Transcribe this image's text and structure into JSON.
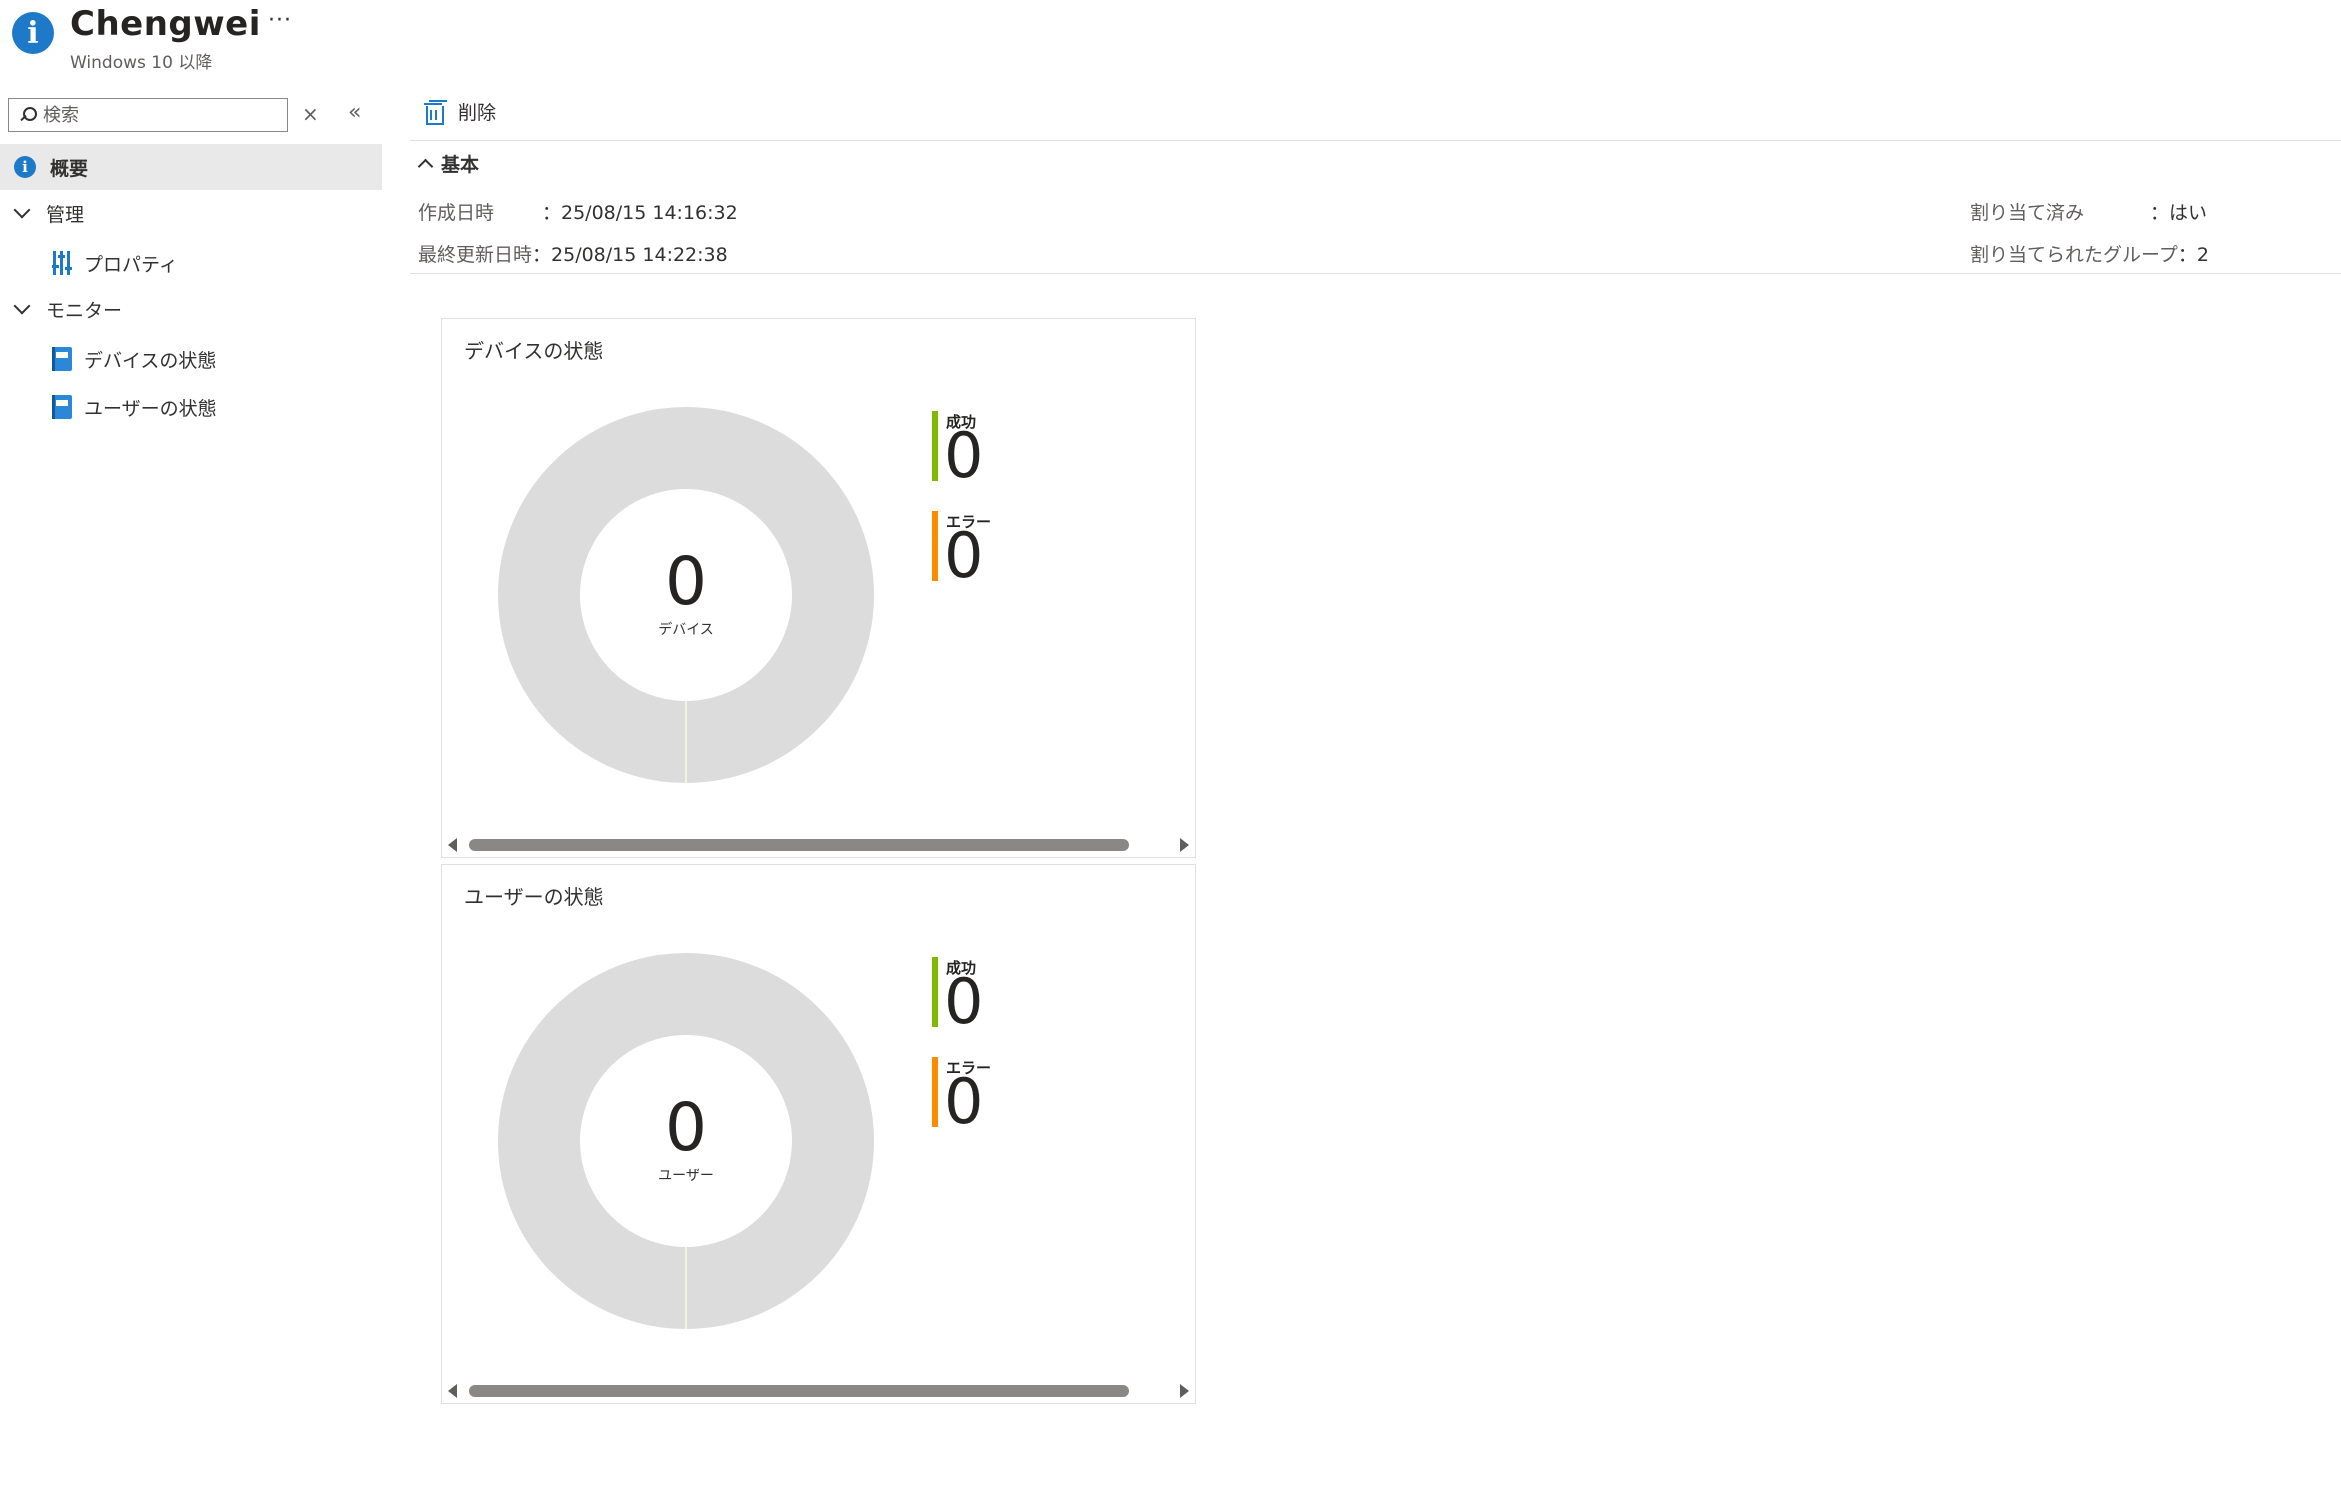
{
  "header": {
    "title": "Chengwei",
    "more": "···",
    "subtitle": "Windows 10 以降"
  },
  "sidebar": {
    "search_placeholder": "検索",
    "clear": "×",
    "collapse": "«",
    "items": [
      {
        "label": "概要",
        "icon": "info-icon",
        "active": true
      },
      {
        "label": "管理",
        "type": "group"
      },
      {
        "label": "プロパティ",
        "icon": "properties-icon"
      },
      {
        "label": "モニター",
        "type": "group"
      },
      {
        "label": "デバイスの状態",
        "icon": "book-icon"
      },
      {
        "label": "ユーザーの状態",
        "icon": "book-icon"
      }
    ]
  },
  "toolbar": {
    "delete_label": "削除"
  },
  "essentials": {
    "section_label": "基本",
    "created_label": "作成日時",
    "created_value": "：25/08/15 14:16:32",
    "modified_label": "最終更新日時",
    "modified_value": "：25/08/15 14:22:38",
    "assigned_label": "割り当て済み",
    "assigned_value": "：はい",
    "groups_label": "割り当てられたグループ",
    "groups_value": "：2"
  },
  "cards": [
    {
      "title": "デバイスの状態",
      "center_value": "0",
      "center_unit": "デバイス",
      "legend": [
        {
          "label": "成功",
          "value": "0",
          "color": "#7fba00"
        },
        {
          "label": "エラー",
          "value": "0",
          "color": "#ff8c00"
        }
      ]
    },
    {
      "title": "ユーザーの状態",
      "center_value": "0",
      "center_unit": "ユーザー",
      "legend": [
        {
          "label": "成功",
          "value": "0",
          "color": "#7fba00"
        },
        {
          "label": "エラー",
          "value": "0",
          "color": "#ff8c00"
        }
      ]
    }
  ],
  "colors": {
    "accent": "#1e7ac8",
    "success": "#7fba00",
    "error": "#ff8c00",
    "donut_empty": "#dcdcdc"
  }
}
